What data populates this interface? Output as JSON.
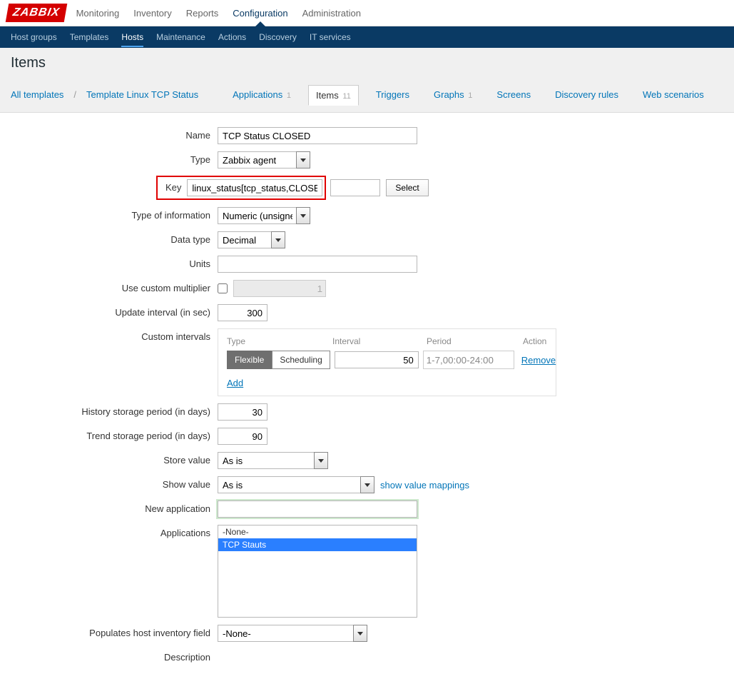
{
  "logo": "ZABBIX",
  "topnav": [
    "Monitoring",
    "Inventory",
    "Reports",
    "Configuration",
    "Administration"
  ],
  "topnav_active": 3,
  "subnav": [
    "Host groups",
    "Templates",
    "Hosts",
    "Maintenance",
    "Actions",
    "Discovery",
    "IT services"
  ],
  "subnav_active": 2,
  "page_title": "Items",
  "breadcrumb": {
    "all_templates": "All templates",
    "template": "Template Linux TCP Status"
  },
  "tabs": [
    {
      "label": "Applications",
      "count": "1"
    },
    {
      "label": "Items",
      "count": "11",
      "active": true
    },
    {
      "label": "Triggers",
      "count": ""
    },
    {
      "label": "Graphs",
      "count": "1"
    },
    {
      "label": "Screens",
      "count": ""
    },
    {
      "label": "Discovery rules",
      "count": ""
    },
    {
      "label": "Web scenarios",
      "count": ""
    }
  ],
  "form": {
    "name_label": "Name",
    "name_value": "TCP Status CLOSED",
    "type_label": "Type",
    "type_value": "Zabbix agent",
    "key_label": "Key",
    "key_value": "linux_status[tcp_status,CLOSED]",
    "select_btn": "Select",
    "info_label": "Type of information",
    "info_value": "Numeric (unsigned)",
    "datatype_label": "Data type",
    "datatype_value": "Decimal",
    "units_label": "Units",
    "units_value": "",
    "multiplier_label": "Use custom multiplier",
    "multiplier_value": "1",
    "update_label": "Update interval (in sec)",
    "update_value": "300",
    "custom_label": "Custom intervals",
    "custom_head": [
      "Type",
      "Interval",
      "Period",
      "Action"
    ],
    "flexible": "Flexible",
    "scheduling": "Scheduling",
    "interval_val": "50",
    "period_val": "1-7,00:00-24:00",
    "remove": "Remove",
    "add": "Add",
    "history_label": "History storage period (in days)",
    "history_value": "30",
    "trend_label": "Trend storage period (in days)",
    "trend_value": "90",
    "store_label": "Store value",
    "store_value": "As is",
    "show_label": "Show value",
    "show_value": "As is",
    "show_link": "show value mappings",
    "newapp_label": "New application",
    "newapp_value": "",
    "apps_label": "Applications",
    "apps_options": [
      "-None-",
      "TCP Stauts"
    ],
    "apps_selected": 1,
    "populates_label": "Populates host inventory field",
    "populates_value": "-None-",
    "description_label": "Description"
  }
}
